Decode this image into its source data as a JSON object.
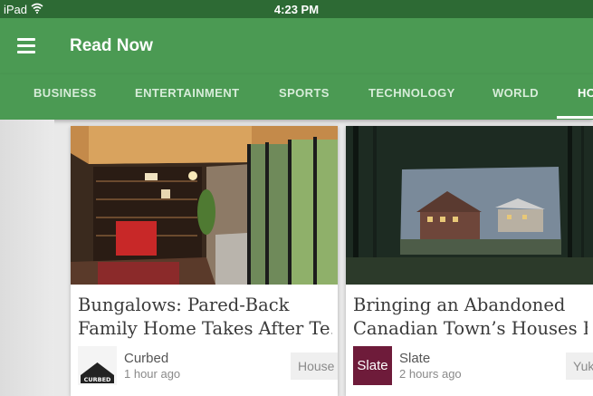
{
  "status_bar": {
    "carrier": "iPad",
    "time": "4:23 PM",
    "icons": [
      "wifi-icon"
    ]
  },
  "app_bar": {
    "title": "Read Now",
    "menu_icon": "hamburger-menu-icon"
  },
  "tabs": [
    {
      "label": "BUSINESS",
      "active": false
    },
    {
      "label": "ENTERTAINMENT",
      "active": false
    },
    {
      "label": "SPORTS",
      "active": false
    },
    {
      "label": "TECHNOLOGY",
      "active": false
    },
    {
      "label": "WORLD",
      "active": false
    },
    {
      "label": "HO",
      "active": true
    }
  ],
  "cards": [
    {
      "headline": "Bungalows: Pared-Back\nFamily Home Takes After Te…",
      "source_name": "Curbed",
      "source_logo_text": "CURBED",
      "time": "1 hour ago",
      "topic": "House"
    },
    {
      "headline": "Bringing an Abandoned\nCanadian Town’s Houses Ba…",
      "source_name": "Slate",
      "source_logo_text": "Slate",
      "time": "2 hours ago",
      "topic": "Yuk"
    }
  ],
  "colors": {
    "app_bar": "#4b9a53",
    "status_bar": "#2d6a34",
    "slate_brand": "#6e1b3a",
    "background": "#e9e9e9"
  }
}
